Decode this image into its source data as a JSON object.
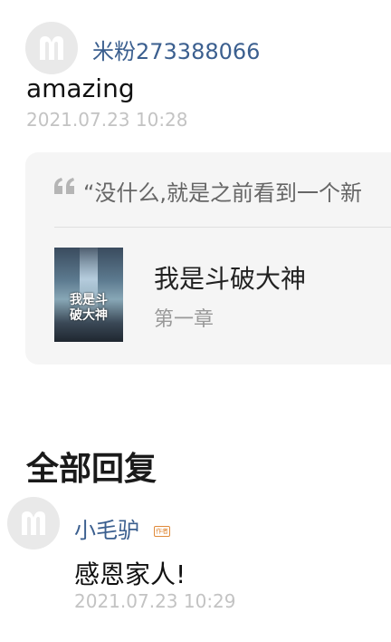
{
  "comment": {
    "username": "米粉273388066",
    "text": "amazing",
    "time": "2021.07.23 10:28"
  },
  "quote": {
    "text": "“没什么,就是之前看到一个新",
    "book": {
      "cover_title": "我是斗破大神",
      "title": "我是斗破大神",
      "chapter": "第一章"
    }
  },
  "replies": {
    "section_title": "全部回复",
    "items": [
      {
        "username": "小毛驴",
        "badge": "作者",
        "text": "感恩家人!",
        "time": "2021.07.23 10:29"
      }
    ]
  }
}
